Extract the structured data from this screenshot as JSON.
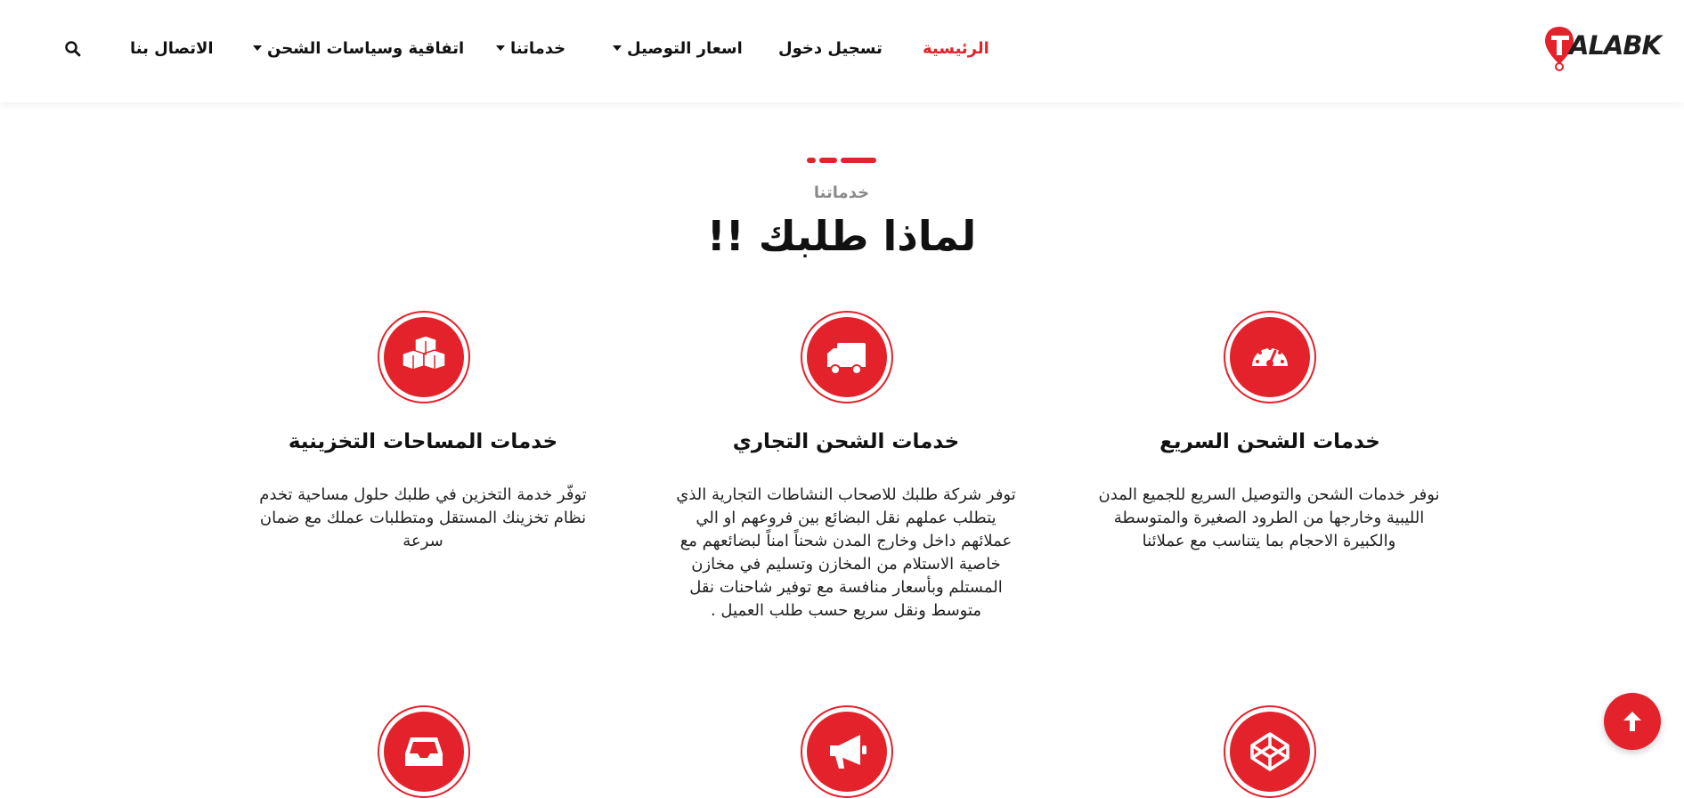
{
  "brand": {
    "logo_text": "ALABK",
    "logo_letter": "T",
    "accent_color": "#e3222b"
  },
  "nav": {
    "items": [
      {
        "label": "الرئيسية",
        "active": true,
        "dropdown": false
      },
      {
        "label": "تسجيل دخول",
        "active": false,
        "dropdown": false
      },
      {
        "label": "اسعار التوصيل",
        "active": false,
        "dropdown": true
      },
      {
        "label": "خدماتنا",
        "active": false,
        "dropdown": true
      },
      {
        "label": "اتفاقية وسياسات الشحن",
        "active": false,
        "dropdown": true
      },
      {
        "label": "الاتصال بنا",
        "active": false,
        "dropdown": false
      }
    ],
    "search_icon": "search-icon"
  },
  "section": {
    "kicker": "خدماتنا",
    "title": "لماذا طلبك !!"
  },
  "features": [
    {
      "icon": "speedometer-icon",
      "title": "خدمات الشحن السريع",
      "text": "نوفر خدمات الشحن والتوصيل السريع للجميع المدن الليبية وخارجها من الطرود الصغيرة والمتوسطة والكبيرة الاحجام بما يتناسب مع عملائنا"
    },
    {
      "icon": "truck-icon",
      "title": "خدمات الشحن التجاري",
      "text": "توفر شركة طلبك للاصحاب النشاطات التجارية الذي يتطلب عملهم نقل البضائع بين فروعهم او الي عملائهم داخل وخارج المدن شحناً امناً لبضائعهم مع خاصية الاستلام من المخازن وتسليم في مخازن المستلم وبأسعار منافسة مع توفير شاحنات نقل متوسط ونقل سريع حسب طلب العميل ."
    },
    {
      "icon": "boxes-icon",
      "title": "خدمات المساحات التخزينية",
      "text": "توفّر خدمة التخزين في طلبك حلول مساحية تخدم نظام تخزينك المستقل ومتطلبات عملك مع ضمان سرعة"
    },
    {
      "icon": "codepen-cube-icon"
    },
    {
      "icon": "megaphone-icon"
    },
    {
      "icon": "inbox-tray-icon"
    }
  ],
  "scroll_top_icon": "arrow-up-icon"
}
